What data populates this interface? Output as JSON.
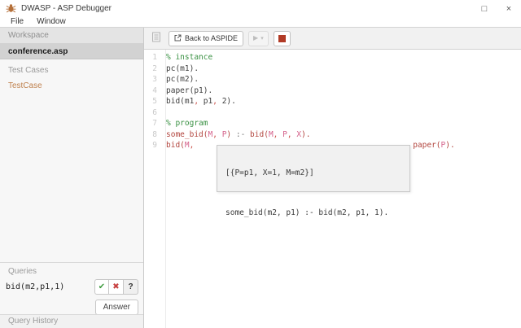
{
  "window": {
    "title": "DWASP - ASP Debugger",
    "maximize_glyph": "□",
    "close_glyph": "×"
  },
  "menu": {
    "items": [
      "File",
      "Window"
    ]
  },
  "sidebar": {
    "workspace_header": "Workspace",
    "active_file": "conference.asp",
    "testcases_header": "Test Cases",
    "testcase_item": "TestCase",
    "queries": {
      "header": "Queries",
      "query": "bid(m2,p1,1)",
      "accept_glyph": "✔",
      "reject_glyph": "✖",
      "help_glyph": "?",
      "answer_label": "Answer"
    },
    "history_header": "Query History"
  },
  "toolbar": {
    "back_label": "Back to ASPIDE",
    "play_glyph": "▶",
    "caret_glyph": "▾"
  },
  "editor": {
    "lines": [
      {
        "no": "1",
        "segs": [
          [
            "% instance",
            "cm"
          ]
        ]
      },
      {
        "no": "2",
        "segs": [
          [
            "pc(m1).",
            "pl"
          ]
        ]
      },
      {
        "no": "3",
        "segs": [
          [
            "pc(m2).",
            "pl"
          ]
        ]
      },
      {
        "no": "4",
        "segs": [
          [
            "paper(p1).",
            "pl"
          ]
        ]
      },
      {
        "no": "5",
        "segs": [
          [
            "bid(m1",
            "pl"
          ],
          [
            ",",
            "pn"
          ],
          [
            " p1",
            "pl"
          ],
          [
            ",",
            "pn"
          ],
          [
            " 2).",
            "pl"
          ]
        ]
      },
      {
        "no": "6",
        "segs": []
      },
      {
        "no": "7",
        "segs": [
          [
            "% program",
            "cm"
          ]
        ]
      },
      {
        "no": "8",
        "segs": [
          [
            "some_bid(",
            "pr"
          ],
          [
            "M",
            "vr"
          ],
          [
            ",",
            "pn"
          ],
          [
            " ",
            "pl"
          ],
          [
            "P",
            "vr"
          ],
          [
            ")",
            "pr"
          ],
          [
            " :- ",
            "op"
          ],
          [
            "bid(",
            "pr"
          ],
          [
            "M",
            "vr"
          ],
          [
            ",",
            "pn"
          ],
          [
            " ",
            "pl"
          ],
          [
            "P",
            "vr"
          ],
          [
            ",",
            "pn"
          ],
          [
            " ",
            "pl"
          ],
          [
            "X",
            "vr"
          ],
          [
            ").",
            "pr"
          ]
        ]
      },
      {
        "no": "9",
        "segs": [
          [
            "bid(",
            "pr"
          ],
          [
            "M",
            "vr"
          ],
          [
            ",",
            "pn"
          ],
          [
            "                                               ",
            "pl"
          ],
          [
            "paper(",
            "pr"
          ],
          [
            "P",
            "vr"
          ],
          [
            ").",
            "pr"
          ]
        ]
      }
    ],
    "tooltip": {
      "line1": "[{P=p1, X=1, M=m2}]",
      "line2": "some_bid(m2, p1) :- bid(m2, p1, 1)."
    }
  },
  "colors": {
    "comment_green": "#3a9143",
    "plain_text": "#3c3c3c",
    "punctuation_red": "#ca4d45",
    "predicate_red": "#b2453e",
    "variable_pink": "#d4618a",
    "stop_red": "#b13a25",
    "accept_green": "#3f9b3f",
    "reject_red": "#c74040",
    "testcase_orange": "#c0824f",
    "toolbar_bg": "#f1f1f1",
    "selected_item_bg": "#d2d2d2"
  }
}
